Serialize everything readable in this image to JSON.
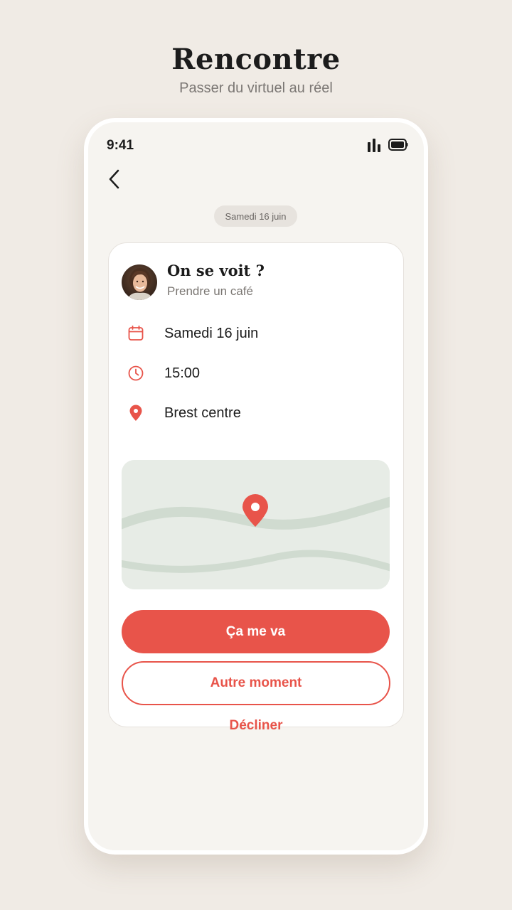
{
  "header": {
    "title": "Rencontre",
    "subtitle": "Passer du virtuel au réel"
  },
  "status_bar": {
    "time": "9:41",
    "icons": [
      "signal-icon",
      "battery-icon"
    ]
  },
  "nav": {
    "back_icon": "chevron-left-icon"
  },
  "date_chip": "Samedi 16 juin",
  "card": {
    "title": "On se voit ?",
    "subtitle": "Prendre un café",
    "details": [
      {
        "icon": "calendar-icon",
        "label": "Samedi 16 juin"
      },
      {
        "icon": "clock-icon",
        "label": "15:00"
      },
      {
        "icon": "location-pin-icon",
        "label": "Brest centre"
      }
    ],
    "map": {
      "marker_icon": "location-pin-icon"
    }
  },
  "actions": {
    "accept_label": "Ça me va",
    "reschedule_label": "Autre moment",
    "decline_label": "Décliner"
  },
  "colors": {
    "accent": "#e8544a",
    "background": "#f0ebe5",
    "phone_screen": "#f6f4f0",
    "card": "#ffffff",
    "map": "#e7ece6"
  }
}
